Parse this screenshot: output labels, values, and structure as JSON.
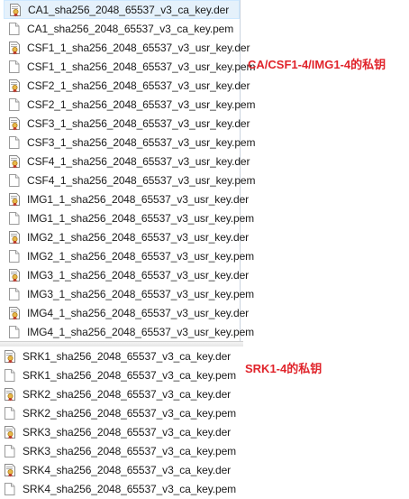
{
  "group1": {
    "files": [
      {
        "name": "CA1_sha256_2048_65537_v3_ca_key.der",
        "icon": "certificate-der-icon",
        "selected": true
      },
      {
        "name": "CA1_sha256_2048_65537_v3_ca_key.pem",
        "icon": "pem-file-icon"
      },
      {
        "name": "CSF1_1_sha256_2048_65537_v3_usr_key.der",
        "icon": "certificate-der-icon"
      },
      {
        "name": "CSF1_1_sha256_2048_65537_v3_usr_key.pem",
        "icon": "pem-file-icon"
      },
      {
        "name": "CSF2_1_sha256_2048_65537_v3_usr_key.der",
        "icon": "certificate-der-icon"
      },
      {
        "name": "CSF2_1_sha256_2048_65537_v3_usr_key.pem",
        "icon": "pem-file-icon"
      },
      {
        "name": "CSF3_1_sha256_2048_65537_v3_usr_key.der",
        "icon": "certificate-der-icon"
      },
      {
        "name": "CSF3_1_sha256_2048_65537_v3_usr_key.pem",
        "icon": "pem-file-icon"
      },
      {
        "name": "CSF4_1_sha256_2048_65537_v3_usr_key.der",
        "icon": "certificate-der-icon"
      },
      {
        "name": "CSF4_1_sha256_2048_65537_v3_usr_key.pem",
        "icon": "pem-file-icon"
      },
      {
        "name": "IMG1_1_sha256_2048_65537_v3_usr_key.der",
        "icon": "certificate-der-icon"
      },
      {
        "name": "IMG1_1_sha256_2048_65537_v3_usr_key.pem",
        "icon": "pem-file-icon"
      },
      {
        "name": "IMG2_1_sha256_2048_65537_v3_usr_key.der",
        "icon": "certificate-der-icon"
      },
      {
        "name": "IMG2_1_sha256_2048_65537_v3_usr_key.pem",
        "icon": "pem-file-icon"
      },
      {
        "name": "IMG3_1_sha256_2048_65537_v3_usr_key.der",
        "icon": "certificate-der-icon"
      },
      {
        "name": "IMG3_1_sha256_2048_65537_v3_usr_key.pem",
        "icon": "pem-file-icon"
      },
      {
        "name": "IMG4_1_sha256_2048_65537_v3_usr_key.der",
        "icon": "certificate-der-icon"
      },
      {
        "name": "IMG4_1_sha256_2048_65537_v3_usr_key.pem",
        "icon": "pem-file-icon"
      }
    ],
    "annotation": "CA/CSF1-4/IMG1-4的私钥"
  },
  "group2": {
    "files": [
      {
        "name": "SRK1_sha256_2048_65537_v3_ca_key.der",
        "icon": "certificate-der-icon"
      },
      {
        "name": "SRK1_sha256_2048_65537_v3_ca_key.pem",
        "icon": "pem-file-icon"
      },
      {
        "name": "SRK2_sha256_2048_65537_v3_ca_key.der",
        "icon": "certificate-der-icon"
      },
      {
        "name": "SRK2_sha256_2048_65537_v3_ca_key.pem",
        "icon": "pem-file-icon"
      },
      {
        "name": "SRK3_sha256_2048_65537_v3_ca_key.der",
        "icon": "certificate-der-icon"
      },
      {
        "name": "SRK3_sha256_2048_65537_v3_ca_key.pem",
        "icon": "pem-file-icon"
      },
      {
        "name": "SRK4_sha256_2048_65537_v3_ca_key.der",
        "icon": "certificate-der-icon"
      },
      {
        "name": "SRK4_sha256_2048_65537_v3_ca_key.pem",
        "icon": "pem-file-icon"
      }
    ],
    "annotation": "SRK1-4的私钥"
  },
  "colors": {
    "annotation_red": "#e0242b",
    "selection_bg": "#e5f1fb",
    "certificate_icon_gold": "#e8b84a"
  }
}
